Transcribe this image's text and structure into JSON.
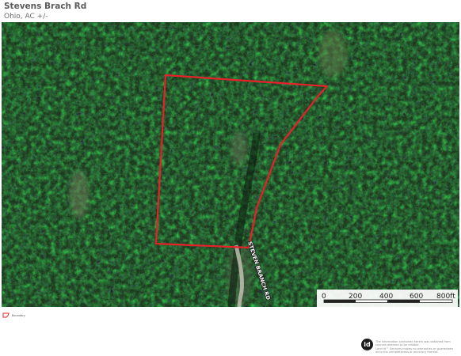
{
  "header": {
    "title": "Stevens Brach Rd",
    "subtitle": "Ohio,  AC +/-"
  },
  "map": {
    "road_label": "STEVEN BRANCH RD",
    "boundary_color": "#e8202a",
    "imagery": "satellite-forest"
  },
  "scale": {
    "ticks": [
      "0",
      "200",
      "400",
      "600",
      "800ft"
    ]
  },
  "legend": {
    "items": [
      {
        "label": "Boundary",
        "color": "#e8202a"
      }
    ]
  },
  "footer": {
    "logo_text": "id",
    "disclaimer_lines": [
      "The information contained herein was obtained from",
      "sources deemed to be reliable.",
      "Land id™ Services makes no warranties or guarantees",
      "as to the completeness or accuracy thereof."
    ]
  }
}
